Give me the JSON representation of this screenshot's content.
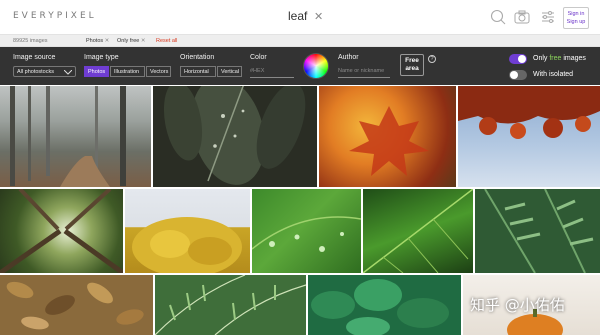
{
  "header": {
    "logo": "EVERYPIXEL",
    "search_query": "leaf",
    "clear_symbol": "✕",
    "icons": [
      "search-icon",
      "camera-icon",
      "filters-icon"
    ],
    "sign_in": "Sign in",
    "sign_up": "Sign up"
  },
  "filterbar": {
    "result_count": "89925 images",
    "chips": [
      {
        "label": "Photos",
        "remove": "✕"
      },
      {
        "label": "Only free",
        "remove": "✕"
      }
    ],
    "reset": "Reset all"
  },
  "panel": {
    "image_source": {
      "label": "Image source",
      "value": "All photostocks"
    },
    "image_type": {
      "label": "Image type",
      "options": [
        "Photos",
        "Illustration",
        "Vectors"
      ],
      "selected": "Photos"
    },
    "orientation": {
      "label": "Orientation",
      "options": [
        "Horizontal",
        "Vertical"
      ]
    },
    "color": {
      "label": "Color",
      "placeholder": "#HEX"
    },
    "author": {
      "label": "Author",
      "placeholder": "Name or nickname"
    },
    "free_area": {
      "line1": "Free",
      "line2": "area",
      "help": "?"
    },
    "only_free": {
      "prefix": "Only ",
      "highlight": "free",
      "suffix": " images",
      "on": true
    },
    "with_isolated": {
      "label": "With isolated",
      "on": false
    },
    "accent_color": "#6f3dd2",
    "free_color": "#8bd35b"
  },
  "watermark": "知乎 @小佑佑",
  "photos": [
    {
      "subject": "foggy-forest-path"
    },
    {
      "subject": "wet-dark-leaves"
    },
    {
      "subject": "autumn-maple-leaf"
    },
    {
      "subject": "red-leaves-blue-sky"
    },
    {
      "subject": "tall-trees-canopy"
    },
    {
      "subject": "yellow-tree-crown"
    },
    {
      "subject": "leaf-with-water-drops"
    },
    {
      "subject": "green-leaf-closeup"
    },
    {
      "subject": "fern-pattern"
    },
    {
      "subject": "dry-autumn-leaves"
    },
    {
      "subject": "fern-fronds"
    },
    {
      "subject": "green-leaves-cluster"
    },
    {
      "subject": "pumpkin-leaves-outdoor"
    }
  ]
}
